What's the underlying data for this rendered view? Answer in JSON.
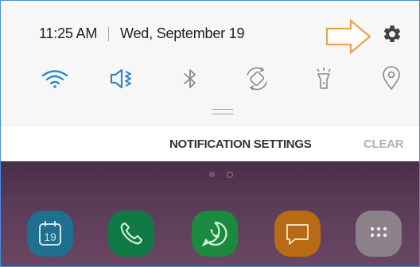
{
  "status_bar": {
    "time": "11:25 AM",
    "date": "Wed, September 19"
  },
  "quick_settings": [
    {
      "icon": "wifi-icon",
      "state": "on"
    },
    {
      "icon": "sound-mute-icon",
      "state": "on"
    },
    {
      "icon": "bluetooth-icon",
      "state": "off"
    },
    {
      "icon": "auto-rotate-icon",
      "state": "off"
    },
    {
      "icon": "flashlight-icon",
      "state": "off"
    },
    {
      "icon": "location-icon",
      "state": "off"
    }
  ],
  "actions": {
    "notification_settings": "NOTIFICATION SETTINGS",
    "clear": "CLEAR"
  },
  "home_screen": {
    "calendar_day": "19",
    "apps": [
      "calendar-icon",
      "phone-icon",
      "whatsapp-icon",
      "messages-icon",
      "apps-drawer-icon"
    ]
  },
  "colors": {
    "accent": "#2f86c9",
    "inactive_icon": "#8a8a8a",
    "arrow": "#f0a14a",
    "clear_text": "#b3b3b3"
  }
}
